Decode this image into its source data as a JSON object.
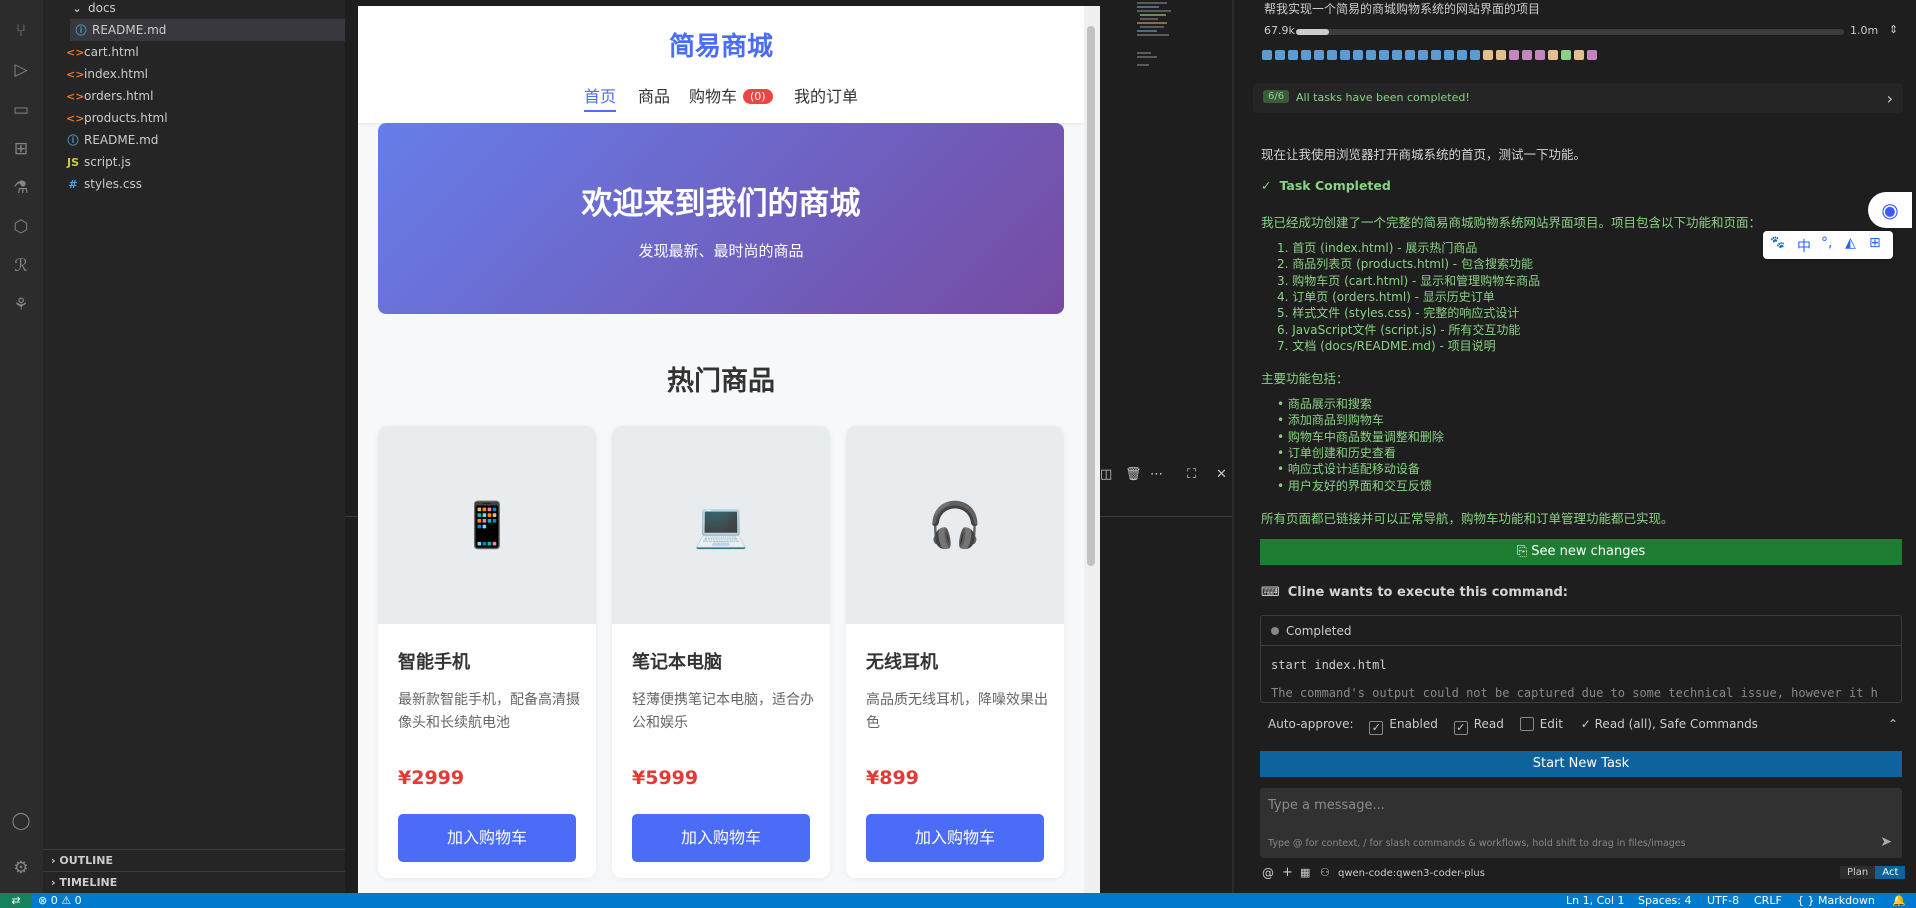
{
  "explorer": {
    "items": [
      {
        "label": "docs",
        "kind": "folder"
      },
      {
        "label": "README.md",
        "kind": "md"
      },
      {
        "label": "cart.html",
        "kind": "html"
      },
      {
        "label": "index.html",
        "kind": "html"
      },
      {
        "label": "orders.html",
        "kind": "html"
      },
      {
        "label": "products.html",
        "kind": "html"
      },
      {
        "label": "README.md",
        "kind": "md"
      },
      {
        "label": "script.js",
        "kind": "js"
      },
      {
        "label": "styles.css",
        "kind": "css"
      }
    ],
    "outline_label": "OUTLINE",
    "timeline_label": "TIMELINE"
  },
  "site": {
    "title": "简易商城",
    "nav": {
      "home": "首页",
      "products": "商品",
      "cart": "购物车",
      "cart_count": "(0)",
      "orders": "我的订单"
    },
    "hero": {
      "title": "欢迎来到我们的商城",
      "subtitle": "发现最新、最时尚的商品"
    },
    "hot_title": "热门商品",
    "products": [
      {
        "name": "智能手机",
        "desc": "最新款智能手机，配备高清摄像头和长续航电池",
        "price": "¥2999",
        "button": "加入购物车",
        "icon": "📱"
      },
      {
        "name": "笔记本电脑",
        "desc": "轻薄便携笔记本电脑，适合办公和娱乐",
        "price": "¥5999",
        "button": "加入购物车",
        "icon": "💻"
      },
      {
        "name": "无线耳机",
        "desc": "高品质无线耳机，降噪效果出色",
        "price": "¥899",
        "button": "加入购物车",
        "icon": "🎧"
      }
    ]
  },
  "cline": {
    "task_title": "帮我实现一个简易的商城购物系统的网站界面的项目",
    "tokens_left": "67.9k",
    "tokens_right": "1.0m",
    "progress_fraction": 0.06,
    "tasks_badge": "6/6",
    "tasks_text": "All tasks have been completed!",
    "intro": "现在让我使用浏览器打开商城系统的首页，测试一下功能。",
    "completed_label": "Task Completed",
    "summary": "我已经成功创建了一个完整的简易商城购物系统网站界面项目。项目包含以下功能和页面：",
    "pages": [
      "首页 (index.html) - 展示热门商品",
      "商品列表页 (products.html) - 包含搜索功能",
      "购物车页 (cart.html) - 显示和管理购物车商品",
      "订单页 (orders.html) - 显示历史订单",
      "样式文件 (styles.css) - 完整的响应式设计",
      "JavaScript文件 (script.js) - 所有交互功能",
      "文档 (docs/README.md) - 项目说明"
    ],
    "features_title": "主要功能包括：",
    "features": [
      "商品展示和搜索",
      "添加商品到购物车",
      "购物车中商品数量调整和删除",
      "订单创建和历史查看",
      "响应式设计适配移动设备",
      "用户友好的界面和交互反馈"
    ],
    "closing": "所有页面都已链接并可以正常导航，购物车功能和订单管理功能都已实现。",
    "see_changes": "See new changes",
    "exec_title": "Cline wants to execute this command:",
    "cmd_status": "Completed",
    "cmd": "start index.html",
    "cmd_truncated": "The command's output could not be captured due to some technical issue, however it h",
    "auto_approve_label": "Auto-approve:",
    "auto_enabled": "Enabled",
    "auto_read": "Read",
    "auto_edit": "Edit",
    "auto_summary": "✓ Read (all), Safe Commands",
    "start_new_task": "Start New Task",
    "msg_placeholder": "Type a message...",
    "msg_hint": "Type @ for context, / for slash commands & workflows, hold shift to drag in files/images",
    "model": "qwen-code:qwen3-coder-plus",
    "plan": "Plan",
    "act": "Act"
  },
  "statusbar": {
    "problems": "⊗ 0 ⚠ 0",
    "ln_col": "Ln 1, Col 1",
    "spaces": "Spaces: 4",
    "encoding": "UTF-8",
    "eol": "CRLF",
    "language": "{ } Markdown"
  },
  "ime": {
    "lang": "中"
  },
  "colors": {
    "accent_blue": "#4a6cf7",
    "price_red": "#e53935",
    "hero_start": "#667eea",
    "hero_end": "#764ba2",
    "success_green": "#89d185",
    "button_green": "#1e7d32",
    "vscode_blue": "#007acc"
  }
}
